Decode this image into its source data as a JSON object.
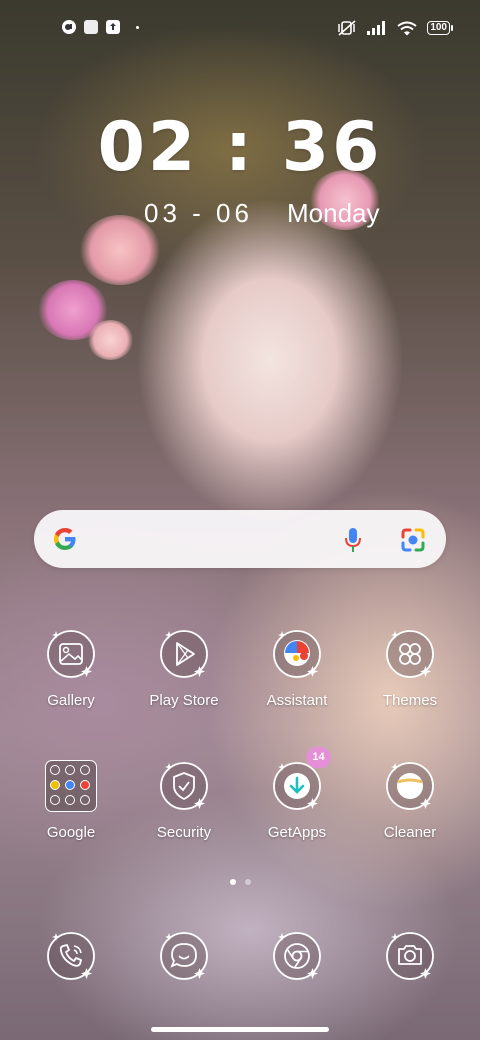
{
  "status_bar": {
    "left_icons": [
      "app-notification-icon",
      "square-notification-icon",
      "upload-icon"
    ],
    "right_icons": [
      "mute-vibrate-icon",
      "signal-icon",
      "wifi-icon",
      "battery-icon"
    ],
    "battery_level": "100"
  },
  "clock": {
    "time": "02 : 36",
    "date": "03 - 06",
    "weekday": "Monday"
  },
  "search_bar": {
    "icons": [
      "google-logo-icon",
      "microphone-icon",
      "google-lens-icon"
    ]
  },
  "apps_row1": [
    {
      "label": "Gallery",
      "icon": "gallery-icon"
    },
    {
      "label": "Play Store",
      "icon": "play-store-icon"
    },
    {
      "label": "Assistant",
      "icon": "assistant-icon"
    },
    {
      "label": "Themes",
      "icon": "themes-icon"
    }
  ],
  "apps_row2": [
    {
      "label": "Google",
      "icon": "google-folder-icon"
    },
    {
      "label": "Security",
      "icon": "security-shield-icon"
    },
    {
      "label": "GetApps",
      "icon": "getapps-download-icon",
      "badge": "14"
    },
    {
      "label": "Cleaner",
      "icon": "cleaner-icon"
    }
  ],
  "dock": [
    {
      "icon": "phone-icon"
    },
    {
      "icon": "messages-icon"
    },
    {
      "icon": "chrome-browser-icon"
    },
    {
      "icon": "camera-icon"
    }
  ],
  "pager": {
    "pages": 2,
    "current": 1
  },
  "colors": {
    "badge": "#e58fd7",
    "search_bg": "#f8f6f8"
  }
}
